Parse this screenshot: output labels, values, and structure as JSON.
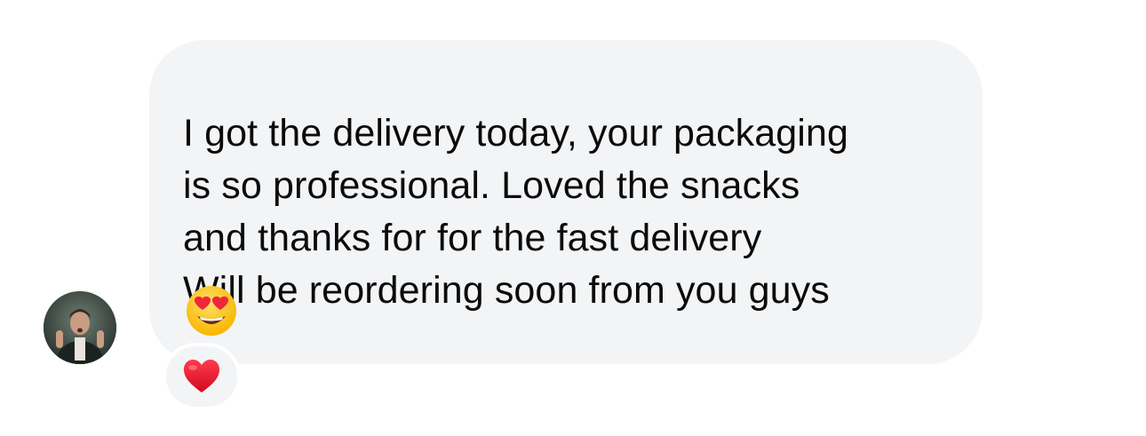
{
  "message": {
    "lines": "I got the delivery today, your packaging\nis so professional. Loved the snacks\nand thanks for for the fast delivery\nWill be reordering soon from you guys",
    "emoji": "smiling-face-with-heart-eyes"
  },
  "reaction": {
    "emoji": "red-heart"
  },
  "colors": {
    "bubble": "#f3f4f6",
    "text": "#0b0b0b",
    "heart": "#e8112d",
    "emoji_face": "#ffcc33"
  }
}
